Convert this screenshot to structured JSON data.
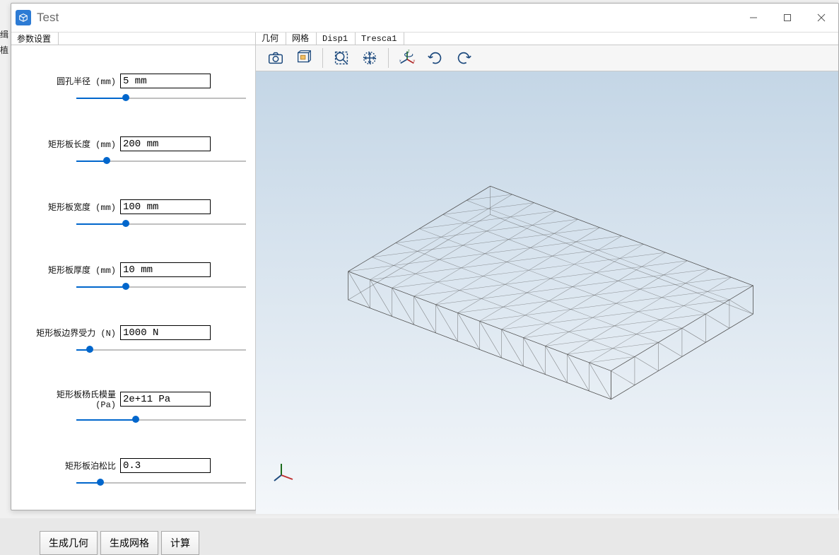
{
  "window": {
    "title": "Test"
  },
  "left_tab": "参数设置",
  "params": [
    {
      "label": "圆孔半径 (mm)",
      "value": "5 mm",
      "fill_pct": 29
    },
    {
      "label": "矩形板长度 (mm)",
      "value": "200 mm",
      "fill_pct": 18
    },
    {
      "label": "矩形板宽度 (mm)",
      "value": "100 mm",
      "fill_pct": 29
    },
    {
      "label": "矩形板厚度 (mm)",
      "value": "10 mm",
      "fill_pct": 29
    },
    {
      "label": "矩形板边界受力 (N)",
      "value": "1000 N",
      "fill_pct": 8
    },
    {
      "label": "矩形板杨氏模量 (Pa)",
      "value": "2e+11 Pa",
      "fill_pct": 35
    },
    {
      "label": "矩形板泊松比",
      "value": "0.3",
      "fill_pct": 14
    }
  ],
  "buttons": {
    "gen_geometry": "生成几何",
    "gen_mesh": "生成网格",
    "compute": "计算"
  },
  "right_tabs": [
    "几何",
    "网格",
    "Disp1",
    "Tresca1"
  ],
  "toolbar_icons": [
    "camera",
    "fit-box",
    "zoom-box",
    "pan",
    "axes",
    "rotate-cw",
    "rotate-ccw"
  ],
  "colors": {
    "accent": "#0066cc",
    "icon_stroke": "#1c497d"
  }
}
